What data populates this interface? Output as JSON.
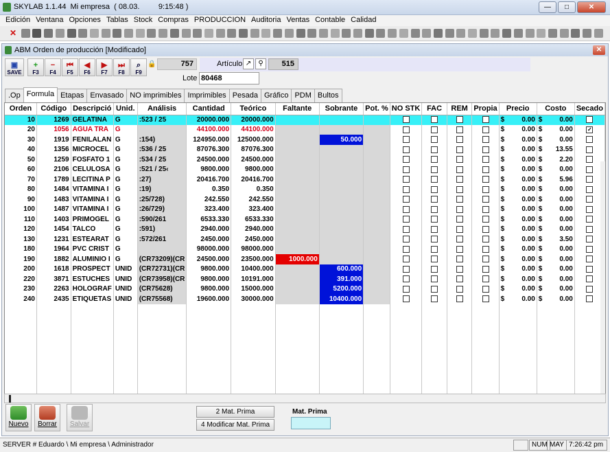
{
  "window": {
    "title": "SKYLAB 1.1.44  Mi empresa  ( 08.03.         9:15:48 )"
  },
  "menu": [
    "Edición",
    "Ventana",
    "Opciones",
    "Tablas",
    "Stock",
    "Compras",
    "PRODUCCION",
    "Auditoria",
    "Ventas",
    "Contable",
    "Calidad"
  ],
  "form": {
    "title": "ABM Orden de producción  [Modificado]",
    "buttons": [
      {
        "icon": "save-icon",
        "label": "SAVE"
      },
      {
        "icon": "plus-icon",
        "label": "F3"
      },
      {
        "icon": "minus-icon",
        "label": "F4"
      },
      {
        "icon": "first-icon",
        "label": "F5"
      },
      {
        "icon": "prev-icon",
        "label": "F6"
      },
      {
        "icon": "next-icon",
        "label": "F7"
      },
      {
        "icon": "last-icon",
        "label": "F8"
      },
      {
        "icon": "search-icon",
        "label": "F9"
      }
    ],
    "order_number": "757",
    "article_label": "Artículo",
    "article_value": "515",
    "lote_label": "Lote",
    "lote_value": "80468"
  },
  "tabs": [
    ".Op",
    "Formula",
    "Etapas",
    "Envasado",
    "NO imprimibles",
    "Imprimibles",
    "Pesada",
    "Gráfico",
    "PDM",
    "Bultos"
  ],
  "active_tab": "Formula",
  "columns": [
    "Orden",
    "Código",
    "Descripció",
    "Unid.",
    "Análisis",
    "Cantidad",
    "Teórico",
    "Faltante",
    "Sobrante",
    "Pot. %",
    "NO STK",
    "FAC",
    "REM",
    "Propia",
    "Precio",
    "Costo",
    "Secado"
  ],
  "rows": [
    {
      "orden": "10",
      "codigo": "1269",
      "desc": "GELATINA",
      "unid": "G",
      "analisis": ":523 / 25",
      "cantidad": "20000.000",
      "teorico": "20000.000",
      "faltante": "",
      "sobrante": "",
      "precio_sym": "$",
      "precio": "0.00",
      "costo_sym": "$",
      "costo": "0.00",
      "secado": false
    },
    {
      "orden": "20",
      "codigo": "1056",
      "desc": "AGUA TRA",
      "unid": "G",
      "analisis": "",
      "cantidad": "44100.000",
      "teorico": "44100.000",
      "faltante": "",
      "sobrante": "",
      "precio_sym": "$",
      "precio": "0.00",
      "costo_sym": "$",
      "costo": "0.00",
      "secado": true
    },
    {
      "orden": "30",
      "codigo": "1919",
      "desc": "FENILALAN",
      "unid": "G",
      "analisis": ":154)",
      "cantidad": "124950.000",
      "teorico": "125000.000",
      "faltante": "",
      "sobrante": "50.000",
      "precio_sym": "$",
      "precio": "0.00",
      "costo_sym": "$",
      "costo": "0.00",
      "secado": false
    },
    {
      "orden": "40",
      "codigo": "1356",
      "desc": "MICROCEL",
      "unid": "G",
      "analisis": ":536 / 25",
      "cantidad": "87076.300",
      "teorico": "87076.300",
      "faltante": "",
      "sobrante": "",
      "precio_sym": "$",
      "precio": "0.00",
      "costo_sym": "$",
      "costo": "13.55",
      "secado": false
    },
    {
      "orden": "50",
      "codigo": "1259",
      "desc": "FOSFATO 1",
      "unid": "G",
      "analisis": ":534 / 25",
      "cantidad": "24500.000",
      "teorico": "24500.000",
      "faltante": "",
      "sobrante": "",
      "precio_sym": "$",
      "precio": "0.00",
      "costo_sym": "$",
      "costo": "2.20",
      "secado": false
    },
    {
      "orden": "60",
      "codigo": "2106",
      "desc": "CELULOSA",
      "unid": "G",
      "analisis": ":521 / 25‹",
      "cantidad": "9800.000",
      "teorico": "9800.000",
      "faltante": "",
      "sobrante": "",
      "precio_sym": "$",
      "precio": "0.00",
      "costo_sym": "$",
      "costo": "0.00",
      "secado": false
    },
    {
      "orden": "70",
      "codigo": "1789",
      "desc": "LECITINA P",
      "unid": "G",
      "analisis": ":27)",
      "cantidad": "20416.700",
      "teorico": "20416.700",
      "faltante": "",
      "sobrante": "",
      "precio_sym": "$",
      "precio": "0.00",
      "costo_sym": "$",
      "costo": "5.96",
      "secado": false
    },
    {
      "orden": "80",
      "codigo": "1484",
      "desc": "VITAMINA I",
      "unid": "G",
      "analisis": ":19)",
      "cantidad": "0.350",
      "teorico": "0.350",
      "faltante": "",
      "sobrante": "",
      "precio_sym": "$",
      "precio": "0.00",
      "costo_sym": "$",
      "costo": "0.00",
      "secado": false
    },
    {
      "orden": "90",
      "codigo": "1483",
      "desc": "VITAMINA I",
      "unid": "G",
      "analisis": ":25/728)",
      "cantidad": "242.550",
      "teorico": "242.550",
      "faltante": "",
      "sobrante": "",
      "precio_sym": "$",
      "precio": "0.00",
      "costo_sym": "$",
      "costo": "0.00",
      "secado": false
    },
    {
      "orden": "100",
      "codigo": "1487",
      "desc": "VITAMINA I",
      "unid": "G",
      "analisis": ":26/729)",
      "cantidad": "323.400",
      "teorico": "323.400",
      "faltante": "",
      "sobrante": "",
      "precio_sym": "$",
      "precio": "0.00",
      "costo_sym": "$",
      "costo": "0.00",
      "secado": false
    },
    {
      "orden": "110",
      "codigo": "1403",
      "desc": "PRIMOGEL",
      "unid": "G",
      "analisis": ":590/261",
      "cantidad": "6533.330",
      "teorico": "6533.330",
      "faltante": "",
      "sobrante": "",
      "precio_sym": "$",
      "precio": "0.00",
      "costo_sym": "$",
      "costo": "0.00",
      "secado": false
    },
    {
      "orden": "120",
      "codigo": "1454",
      "desc": "TALCO",
      "unid": "G",
      "analisis": ":591)",
      "cantidad": "2940.000",
      "teorico": "2940.000",
      "faltante": "",
      "sobrante": "",
      "precio_sym": "$",
      "precio": "0.00",
      "costo_sym": "$",
      "costo": "0.00",
      "secado": false
    },
    {
      "orden": "130",
      "codigo": "1231",
      "desc": "ESTEARAT",
      "unid": "G",
      "analisis": ":572/261",
      "cantidad": "2450.000",
      "teorico": "2450.000",
      "faltante": "",
      "sobrante": "",
      "precio_sym": "$",
      "precio": "0.00",
      "costo_sym": "$",
      "costo": "3.50",
      "secado": false
    },
    {
      "orden": "180",
      "codigo": "1964",
      "desc": "PVC CRIST",
      "unid": "G",
      "analisis": "",
      "cantidad": "98000.000",
      "teorico": "98000.000",
      "faltante": "",
      "sobrante": "",
      "precio_sym": "$",
      "precio": "0.00",
      "costo_sym": "$",
      "costo": "0.00",
      "secado": false
    },
    {
      "orden": "190",
      "codigo": "1882",
      "desc": "ALUMINIO I",
      "unid": "G",
      "analisis": "(CR73209)(CR",
      "cantidad": "24500.000",
      "teorico": "23500.000",
      "faltante": "1000.000",
      "sobrante": "",
      "precio_sym": "$",
      "precio": "0.00",
      "costo_sym": "$",
      "costo": "0.00",
      "secado": false
    },
    {
      "orden": "200",
      "codigo": "1618",
      "desc": "PROSPECT",
      "unid": "UNID",
      "analisis": "(CR72731)(CR",
      "cantidad": "9800.000",
      "teorico": "10400.000",
      "faltante": "",
      "sobrante": "600.000",
      "precio_sym": "$",
      "precio": "0.00",
      "costo_sym": "$",
      "costo": "0.00",
      "secado": false
    },
    {
      "orden": "220",
      "codigo": "3871",
      "desc": "ESTUCHES",
      "unid": "UNID",
      "analisis": "(CR73958)(CR",
      "cantidad": "9800.000",
      "teorico": "10191.000",
      "faltante": "",
      "sobrante": "391.000",
      "precio_sym": "$",
      "precio": "0.00",
      "costo_sym": "$",
      "costo": "0.00",
      "secado": false
    },
    {
      "orden": "230",
      "codigo": "2263",
      "desc": "HOLOGRAF",
      "unid": "UNID",
      "analisis": "(CR75628)",
      "cantidad": "9800.000",
      "teorico": "15000.000",
      "faltante": "",
      "sobrante": "5200.000",
      "precio_sym": "$",
      "precio": "0.00",
      "costo_sym": "$",
      "costo": "0.00",
      "secado": false
    },
    {
      "orden": "240",
      "codigo": "2435",
      "desc": "ETIQUETAS",
      "unid": "UNID",
      "analisis": "(CR75568)",
      "cantidad": "19600.000",
      "teorico": "30000.000",
      "faltante": "",
      "sobrante": "10400.000",
      "precio_sym": "$",
      "precio": "0.00",
      "costo_sym": "$",
      "costo": "0.00",
      "secado": false
    }
  ],
  "bottom": {
    "nuevo": "Nuevo",
    "borrar": "Borrar",
    "salvar": "Salvar",
    "mat_prima_btn": "2 Mat. Prima",
    "modificar_btn": "4 Modificar Mat. Prima",
    "mat_prima_label": "Mat. Prima",
    "mat_prima_value": ""
  },
  "status": {
    "left": "SERVER # Eduardo \\ Mi empresa \\ Administrador",
    "num": "NUM",
    "may": "MAY",
    "time": "7:26:42 pm"
  },
  "colors": {
    "selected_row": "#37f0f7",
    "sobrante": "#0012d9",
    "faltante": "#e40000",
    "red_text": "#d0001a"
  }
}
